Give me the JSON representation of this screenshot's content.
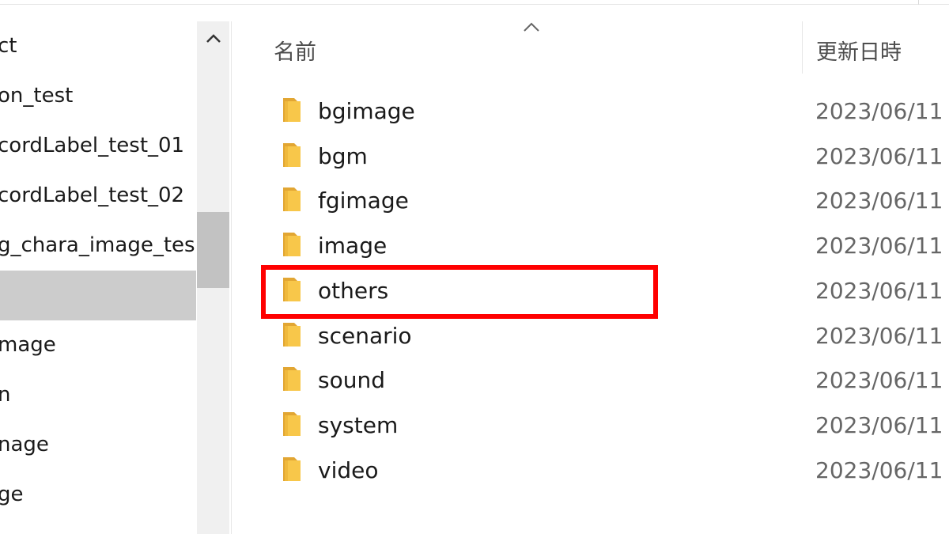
{
  "nav": {
    "items": [
      {
        "label": "ct",
        "selected": false
      },
      {
        "label": "on_test",
        "selected": false
      },
      {
        "label": "cordLabel_test_01",
        "selected": false
      },
      {
        "label": "cordLabel_test_02",
        "selected": false
      },
      {
        "label": "g_chara_image_tes",
        "selected": false
      },
      {
        "label": "",
        "selected": true
      },
      {
        "label": "mage",
        "selected": false
      },
      {
        "label": "n",
        "selected": false
      },
      {
        "label": "nage",
        "selected": false
      },
      {
        "label": "ge",
        "selected": false
      }
    ]
  },
  "columns": {
    "name": "名前",
    "date": "更新日時"
  },
  "files": [
    {
      "name": "bgimage",
      "date": "2023/06/11",
      "icon": "folder-icon"
    },
    {
      "name": "bgm",
      "date": "2023/06/11",
      "icon": "folder-icon"
    },
    {
      "name": "fgimage",
      "date": "2023/06/11",
      "icon": "folder-icon"
    },
    {
      "name": "image",
      "date": "2023/06/11",
      "icon": "folder-icon"
    },
    {
      "name": "others",
      "date": "2023/06/11",
      "icon": "folder-icon"
    },
    {
      "name": "scenario",
      "date": "2023/06/11",
      "icon": "folder-icon"
    },
    {
      "name": "sound",
      "date": "2023/06/11",
      "icon": "folder-icon"
    },
    {
      "name": "system",
      "date": "2023/06/11",
      "icon": "folder-icon"
    },
    {
      "name": "video",
      "date": "2023/06/11",
      "icon": "folder-icon"
    }
  ],
  "colors": {
    "highlight": "#ff0000",
    "folder": "#f8c74a",
    "selected_nav": "#cccccc"
  }
}
